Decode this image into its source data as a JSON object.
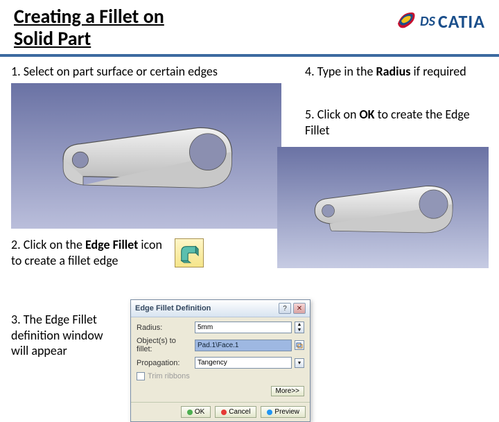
{
  "header": {
    "title_line1": "Creating a Fillet on",
    "title_line2": "Solid Part",
    "logo_prefix": "DS",
    "logo_text": "CATIA"
  },
  "steps": {
    "s1": "1. Select on part surface or certain edges",
    "s2a": "2. Click on the ",
    "s2b": "Edge Fillet",
    "s2c": " icon  to create a fillet edge",
    "s3": "3. The Edge Fillet definition window will appear",
    "s4a": "4. Type in the ",
    "s4b": "Radius",
    "s4c": " if required",
    "s5a": "5. Click on ",
    "s5b": "OK",
    "s5c": " to create the Edge Fillet"
  },
  "dialog": {
    "title": "Edge Fillet Definition",
    "radius_label": "Radius:",
    "radius_value": "5mm",
    "objects_label": "Object(s) to fillet:",
    "objects_value": "Pad.1\\Face.1",
    "propagation_label": "Propagation:",
    "propagation_value": "Tangency",
    "trim_label": "Trim ribbons",
    "more": "More>>",
    "ok": "OK",
    "cancel": "Cancel",
    "preview": "Preview",
    "help_glyph": "?",
    "close_glyph": "✕"
  }
}
